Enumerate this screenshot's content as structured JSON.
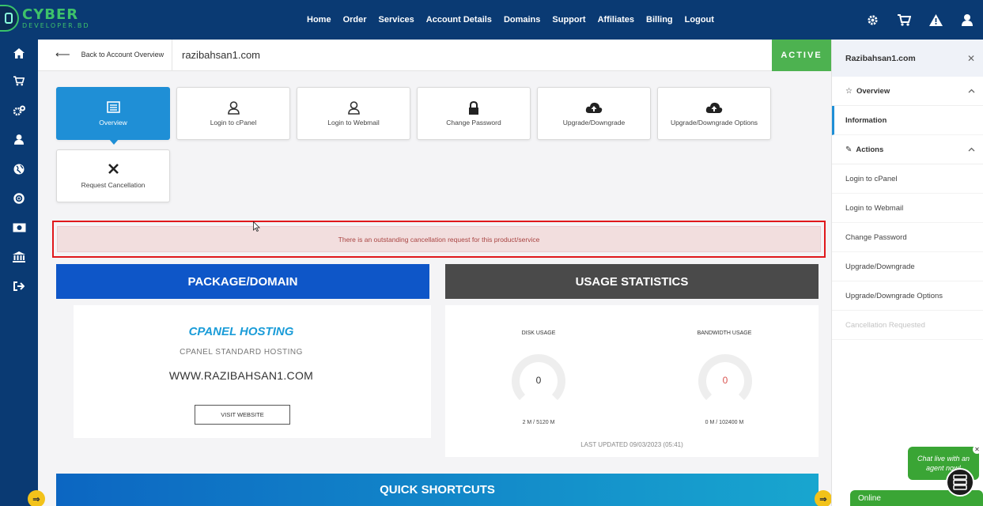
{
  "brand": {
    "line1": "CYBER",
    "line2": "DEVELOPER.BD"
  },
  "nav": {
    "items": [
      "Home",
      "Order",
      "Services",
      "Account Details",
      "Domains",
      "Support",
      "Affiliates",
      "Billing",
      "Logout"
    ],
    "icons": [
      "gear-icon",
      "cart-icon",
      "alert-icon",
      "user-icon"
    ]
  },
  "sidebar_icons": [
    "home-icon",
    "cart-icon",
    "cogs-icon",
    "user-icon",
    "globe-icon",
    "lifebuoy-icon",
    "money-icon",
    "bank-icon",
    "sign-out-icon"
  ],
  "breadcrumb": {
    "back_label": "Back to Account Overview",
    "domain": "razibahsan1.com",
    "status": "ACTIVE"
  },
  "tiles": [
    {
      "label": "Overview",
      "icon": "list-icon",
      "selected": true
    },
    {
      "label": "Login to cPanel",
      "icon": "user-icon"
    },
    {
      "label": "Login to Webmail",
      "icon": "user-icon"
    },
    {
      "label": "Change Password",
      "icon": "lock-icon"
    },
    {
      "label": "Upgrade/Downgrade",
      "icon": "cloud-upload-icon"
    },
    {
      "label": "Upgrade/Downgrade Options",
      "icon": "cloud-upload-icon"
    },
    {
      "label": "Request Cancellation",
      "icon": "close-icon"
    }
  ],
  "alert": {
    "message": "There is an outstanding cancellation request for this product/service"
  },
  "package": {
    "heading": "PACKAGE/DOMAIN",
    "title": "CPANEL HOSTING",
    "subtitle": "CPANEL STANDARD HOSTING",
    "domain": "WWW.RAZIBAHSAN1.COM",
    "visit_label": "VISIT WEBSITE"
  },
  "usage": {
    "heading": "USAGE STATISTICS",
    "disk": {
      "label": "DISK USAGE",
      "value": "0",
      "detail": "2 M / 5120 M"
    },
    "bandwidth": {
      "label": "BANDWIDTH USAGE",
      "value": "0",
      "detail": "0 M / 102400 M"
    },
    "updated": "LAST UPDATED 09/03/2023 (05:41)"
  },
  "quick": {
    "heading": "QUICK SHORTCUTS"
  },
  "right_panel": {
    "title": "Razibahsan1.com",
    "overview_label": "Overview",
    "information_label": "Information",
    "actions_label": "Actions",
    "actions": [
      "Login to cPanel",
      "Login to Webmail",
      "Change Password",
      "Upgrade/Downgrade",
      "Upgrade/Downgrade Options",
      "Cancellation Requested"
    ]
  },
  "chat": {
    "line1": "Chat live with an",
    "line2": "agent now!",
    "status": "Online"
  },
  "colors": {
    "nav": "#0a3a73",
    "accent": "#1f8fd6",
    "active": "#4db250",
    "alert_border": "#e0181c",
    "package_head": "#0e56c8",
    "usage_head": "#4a4a4a",
    "chat": "#3aa535"
  }
}
